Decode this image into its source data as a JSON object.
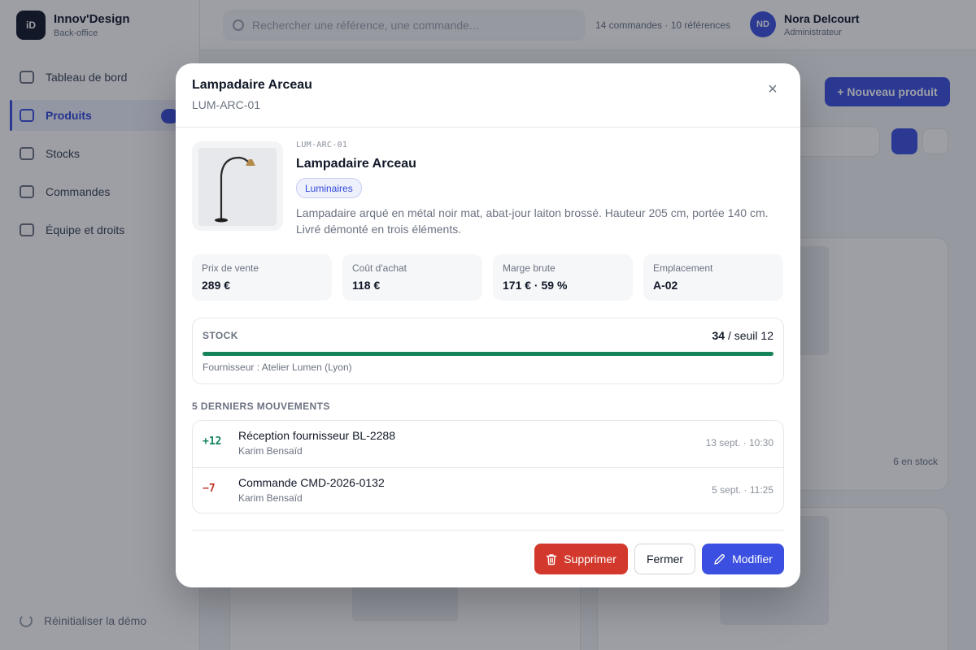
{
  "app": {
    "brand_logo": "iD",
    "brand_name": "Innov'Design",
    "brand_sub": "Back-office",
    "nav": [
      {
        "label": "Tableau de bord"
      },
      {
        "label": "Produits"
      },
      {
        "label": "Stocks"
      },
      {
        "label": "Commandes"
      },
      {
        "label": "Équipe et droits"
      }
    ],
    "reset_label": "Réinitialiser la démo",
    "search_placeholder": "Rechercher une référence, une commande...",
    "top_stats": "14 commandes · 10 références",
    "user": {
      "initials": "ND",
      "name": "Nora Delcourt",
      "role": "Administrateur"
    },
    "new_product_label": "+ Nouveau produit",
    "card_stock": "6 en stock"
  },
  "modal": {
    "title": "Lampadaire Arceau",
    "sku": "LUM-ARC-01",
    "close_icon": "×",
    "product": {
      "code": "LUM-ARC-01",
      "name": "Lampadaire Arceau",
      "category": "Luminaires",
      "description": "Lampadaire arqué en métal noir mat, abat-jour laiton brossé. Hauteur 205 cm, portée 140 cm. Livré démonté en trois éléments."
    },
    "stats": [
      {
        "label": "Prix de vente",
        "value": "289 €"
      },
      {
        "label": "Coût d'achat",
        "value": "118 €"
      },
      {
        "label": "Marge brute",
        "value": "171 € · 59 %"
      },
      {
        "label": "Emplacement",
        "value": "A-02"
      }
    ],
    "stock": {
      "label": "STOCK",
      "quantity": "34",
      "threshold_text": "/ seuil 12",
      "supplier": "Fournisseur : Atelier Lumen (Lyon)",
      "bar_fill_fraction": 1.0,
      "bar_color": "#15845a"
    },
    "movements_title": "5 DERNIERS MOUVEMENTS",
    "movements": [
      {
        "qty": "+12",
        "title": "Réception fournisseur BL-2288",
        "user": "Karim Bensaïd",
        "date": "13 sept. · 10:30"
      },
      {
        "qty": "−7",
        "title": "Commande CMD-2026-0132",
        "user": "Karim Bensaïd",
        "date": "5 sept. · 11:25"
      }
    ],
    "buttons": {
      "delete": "Supprimer",
      "close": "Fermer",
      "edit": "Modifier"
    },
    "colors": {
      "accent": "#3b50e0",
      "danger": "#d2392c",
      "positive": "#15845a",
      "negative": "#c6372c"
    }
  }
}
